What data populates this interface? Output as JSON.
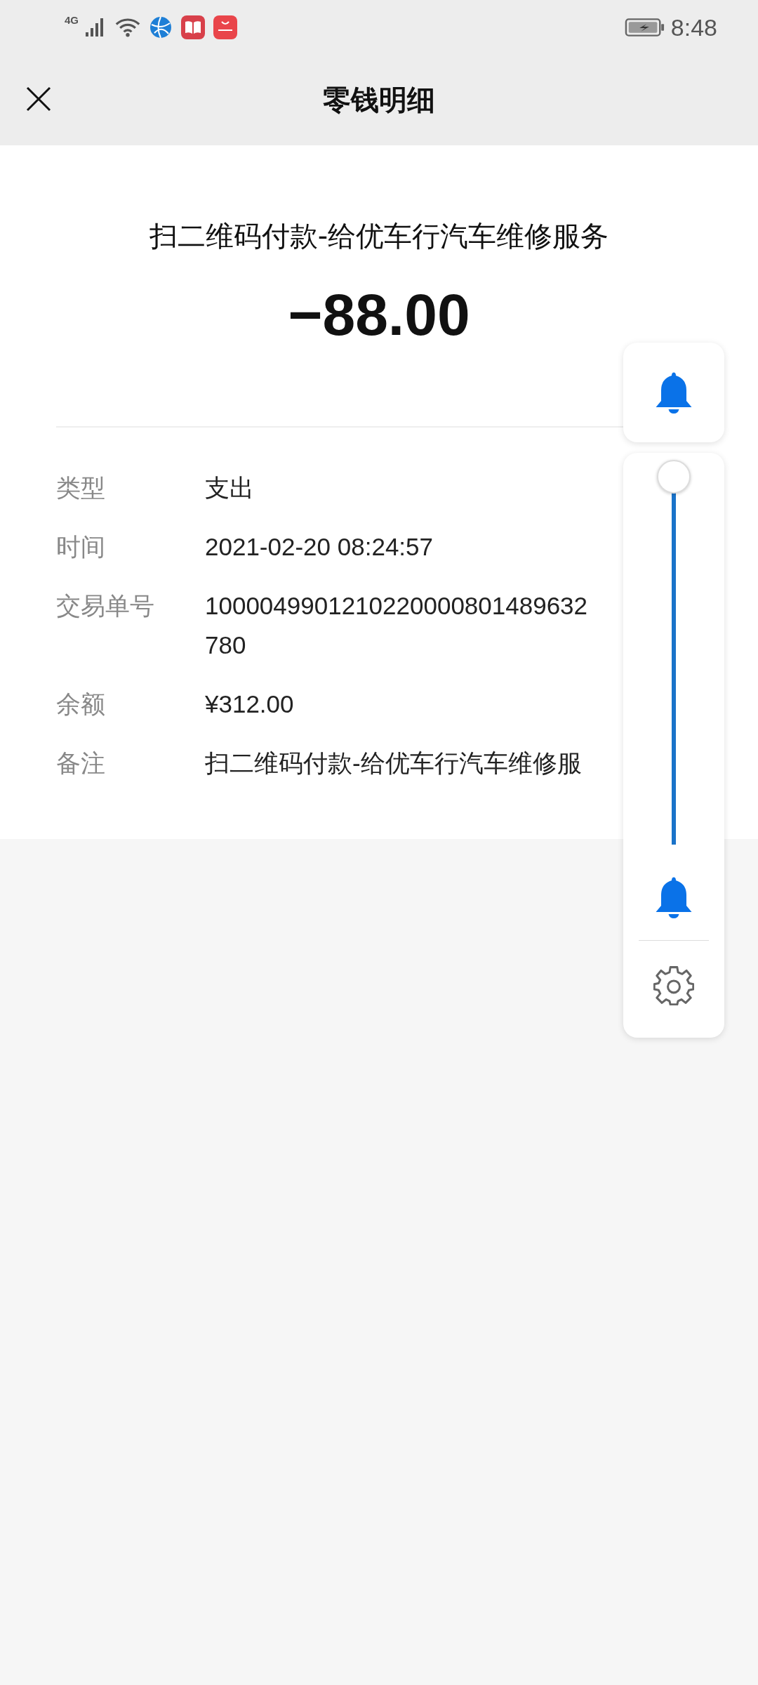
{
  "status_bar": {
    "network": "4G",
    "time": "8:48"
  },
  "header": {
    "title": "零钱明细"
  },
  "summary": {
    "merchant": "扫二维码付款-给优车行汽车维修服务",
    "amount": "−88.00"
  },
  "details": [
    {
      "label": "类型",
      "value": "支出"
    },
    {
      "label": "时间",
      "value": "2021-02-20 08:24:57"
    },
    {
      "label": "交易单号",
      "value": "1000049901210220000801489632780"
    },
    {
      "label": "余额",
      "value": "¥312.00"
    },
    {
      "label": "备注",
      "value": "扫二维码付款-给优车行汽车维修服"
    }
  ],
  "volume_panel": {
    "level": 1
  }
}
